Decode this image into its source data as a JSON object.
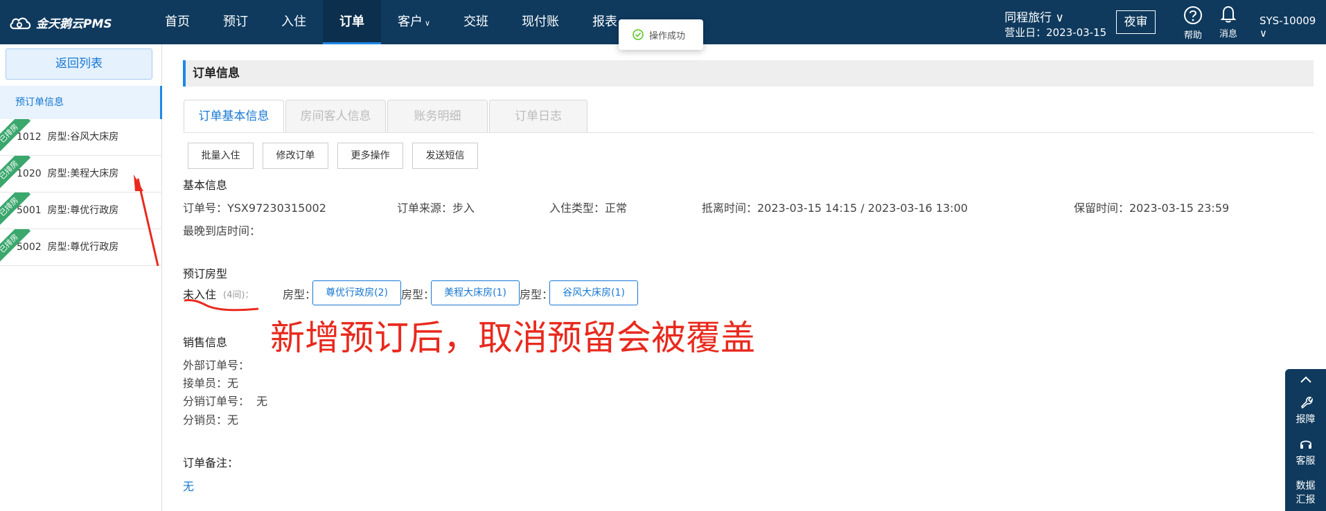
{
  "nav": {
    "logo_text": "金天鹅云PMS",
    "items": [
      {
        "label": "首页",
        "caret": ""
      },
      {
        "label": "预订",
        "caret": ""
      },
      {
        "label": "入住",
        "caret": ""
      },
      {
        "label": "订单",
        "caret": ""
      },
      {
        "label": "客户",
        "caret": "∨"
      },
      {
        "label": "交班",
        "caret": ""
      },
      {
        "label": "现付账",
        "caret": ""
      },
      {
        "label": "报表",
        "caret": "∨"
      }
    ],
    "hotel": "同程旅行 ∨",
    "biz_date": "营业日：2023-03-15",
    "night_audit": "夜审",
    "help": "帮助",
    "messages": "消息",
    "user": "SYS-10009 ∨"
  },
  "toast": {
    "text": "操作成功"
  },
  "sidebar": {
    "back": "返回列表",
    "booking_info": "预订单信息",
    "ribbon": "已排房",
    "rooms": [
      {
        "no": "1012",
        "type": "房型:谷风大床房"
      },
      {
        "no": "1020",
        "type": "房型:美程大床房"
      },
      {
        "no": "5001",
        "type": "房型:尊优行政房"
      },
      {
        "no": "5002",
        "type": "房型:尊优行政房"
      }
    ]
  },
  "main": {
    "section_title": "订单信息",
    "tabs": [
      "订单基本信息",
      "房间客人信息",
      "账务明细",
      "订单日志"
    ],
    "actions": [
      "批量入住",
      "修改订单",
      "更多操作",
      "发送短信"
    ],
    "basic": {
      "title": "基本信息",
      "order_no": "订单号：YSX97230315002",
      "source": "订单来源：步入",
      "checkin_type": "入住类型：正常",
      "stay_time": "抵离时间：2023-03-15 14:15 / 2023-03-16 13:00",
      "reserve_time": "保留时间：2023-03-15 23:59",
      "latest_arrival": "最晚到店时间："
    },
    "room_types": {
      "title": "预订房型",
      "status": "未入住",
      "count": "(4间)：",
      "label": "房型：",
      "tags": [
        "尊优行政房(2)",
        "美程大床房(1)",
        "谷风大床房(1)"
      ]
    },
    "sales": {
      "title": "销售信息",
      "external_no": "外部订单号：",
      "receiver": "接单员：无",
      "dist_no": "分销订单号：  无",
      "distributor": "分销员：无"
    },
    "remarks": {
      "title": "订单备注：",
      "value": "无"
    }
  },
  "annotation": "新增预订后，取消预留会被覆盖",
  "float_panel": {
    "repair": "报障",
    "service": "客服",
    "data1": "数据",
    "data2": "汇报"
  },
  "colors": {
    "nav_bg": "#0f3a5e",
    "accent": "#1677d2",
    "annotation": "#e82a1e",
    "ribbon": "#3aa76d"
  }
}
